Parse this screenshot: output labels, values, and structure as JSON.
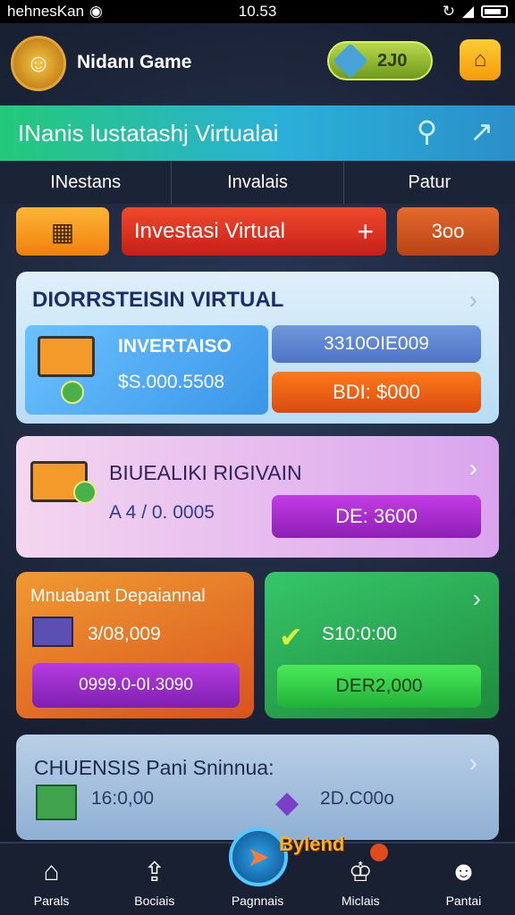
{
  "status_bar": {
    "carrier": "hehnesKan",
    "time": "10.53"
  },
  "header": {
    "brand_name": "Nidanı Game",
    "brand_sub": "",
    "coins": "2J0",
    "shop_icon": "shop-icon"
  },
  "banner": {
    "title": "INanis lustatashj Virtualai"
  },
  "tabs": [
    "INestans",
    "Invalais",
    "Patur"
  ],
  "actions": {
    "invest_label": "Investasi Virtual",
    "plus": "+",
    "num_label": "3oo"
  },
  "card1": {
    "title": "DIORRSTEISIN VIRTUAL",
    "label": "INVERTAISO",
    "value": "$S.000.5508",
    "pill_top": "3310OIE009",
    "pill_bottom": "BDI: $000"
  },
  "card2": {
    "title": "BIUEALIKI RIGIVAIN",
    "value": "A 4 / 0. 0005",
    "pill": "DE: 3600"
  },
  "card3": {
    "title": "Mnuabant Depaiannal",
    "value": "3/08,009",
    "pill": "0999.0-0I.3090"
  },
  "card4": {
    "value": "S10:0:00",
    "pill": "DER2,000"
  },
  "card5": {
    "title": "CHUENSIS Pani Sninnua:",
    "value_left": "16:0,00",
    "value_right": "2D.C00o"
  },
  "floating_tag": "Bylend",
  "bottom_nav": [
    {
      "label": "Parals",
      "icon": "home-icon"
    },
    {
      "label": "Bociais",
      "icon": "upload-icon"
    },
    {
      "label": "Pagnnais",
      "icon": "compass-icon"
    },
    {
      "label": "Miclais",
      "icon": "crown-icon"
    },
    {
      "label": "Pantai",
      "icon": "profile-icon"
    }
  ],
  "colors": {
    "banner_start": "#24c97a",
    "banner_end": "#2b8fc9",
    "invest_red": "#e03322",
    "accent_orange": "#f49b0b"
  }
}
